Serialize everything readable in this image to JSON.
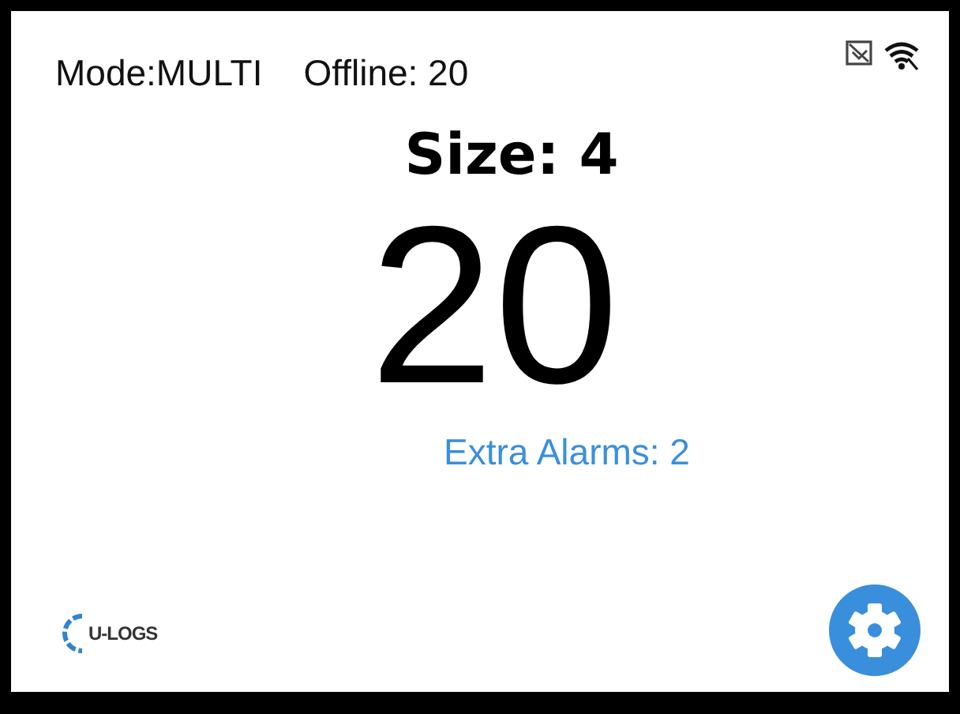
{
  "status_bar": {
    "mode": "Mode:MULTI",
    "offline": "Offline: 20"
  },
  "size_label": "Size: 4",
  "count": "20",
  "extra_alarms": "Extra Alarms: 2",
  "logo": {
    "text": "U-LOGS"
  }
}
